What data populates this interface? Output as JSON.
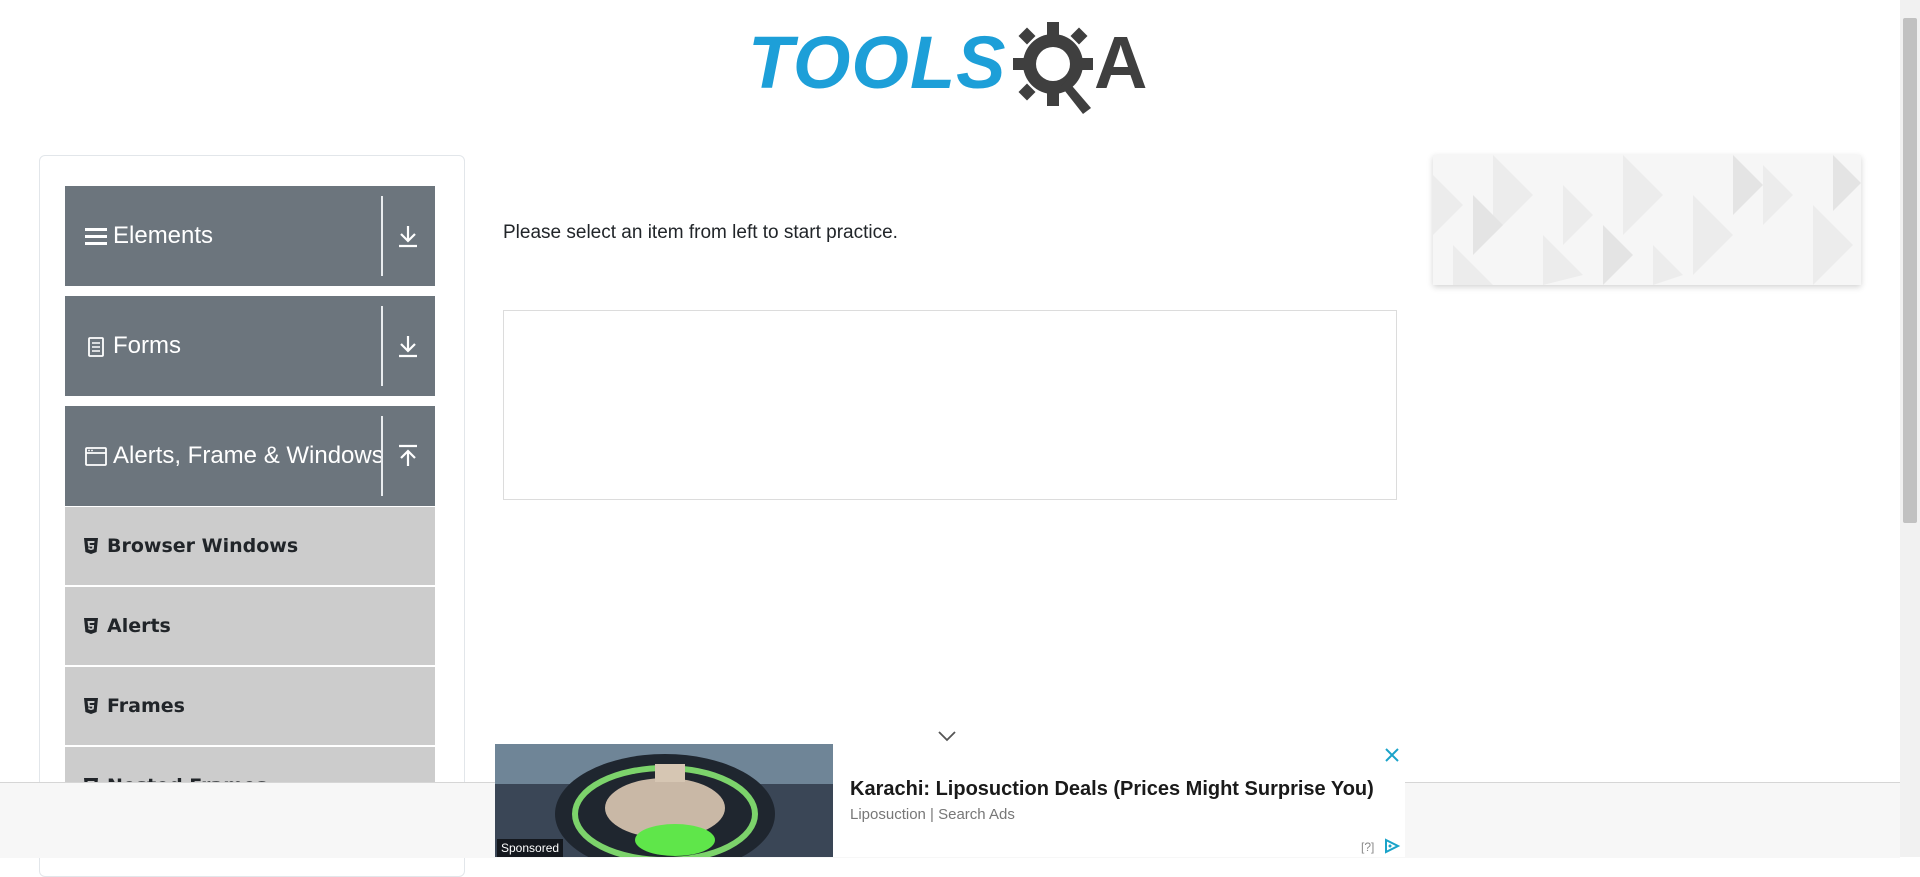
{
  "brand": {
    "logo_text_left": "TOOLS",
    "logo_text_right": "A",
    "primary_color": "#1d9fd8",
    "dark_color": "#3f3f3f"
  },
  "sidebar": {
    "groups": [
      {
        "title": "Elements",
        "icon": "hamburger-icon",
        "state": "collapsed",
        "arrow": "download-arrow-icon"
      },
      {
        "title": "Forms",
        "icon": "document-icon",
        "state": "collapsed",
        "arrow": "download-arrow-icon"
      },
      {
        "title": "Alerts, Frame & Windows",
        "icon": "window-icon",
        "state": "expanded",
        "arrow": "upload-arrow-icon"
      }
    ],
    "sub_items": [
      {
        "title": "Browser Windows",
        "icon": "html5-icon"
      },
      {
        "title": "Alerts",
        "icon": "html5-icon"
      },
      {
        "title": "Frames",
        "icon": "html5-icon"
      },
      {
        "title": "Nested Frames",
        "icon": "html5-icon"
      }
    ],
    "header_color": "#6c757d",
    "item_color": "#cccccc"
  },
  "main": {
    "instruction": "Please select an item from left to start practice."
  },
  "ad": {
    "sponsored_label": "Sponsored",
    "headline": "Karachi: Liposuction Deals (Prices Might Surprise You)",
    "source": "Liposuction | Search Ads",
    "help": "[?]",
    "close_icon": "close-icon",
    "choice_icon": "adchoices-icon"
  }
}
